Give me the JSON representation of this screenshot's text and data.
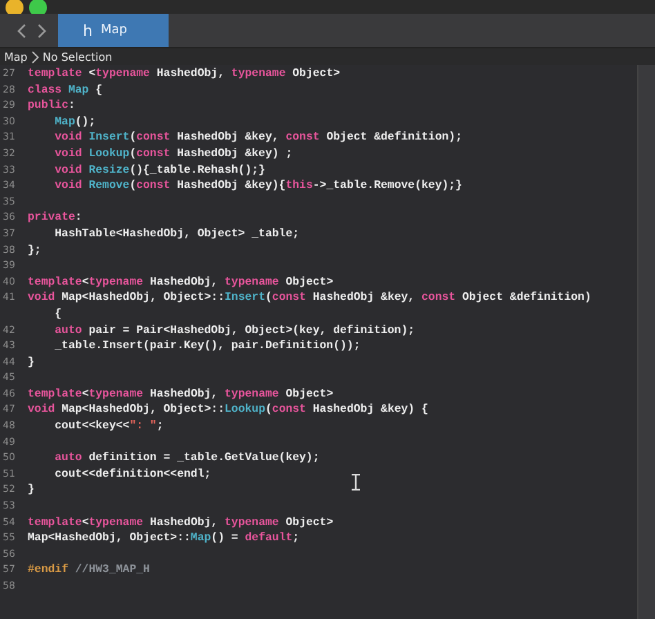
{
  "tabs": [
    {
      "icon": "h",
      "label": "Map",
      "selected": true
    }
  ],
  "breadcrumb": [
    "Map",
    "No Selection"
  ],
  "lines": [
    {
      "number": "27",
      "segments": [
        {
          "kind": "keyword",
          "text": "template"
        },
        {
          "kind": "plain",
          "text": "<",
          "spaced": true
        },
        {
          "kind": "keyword",
          "text": "typename"
        },
        {
          "kind": "plain",
          "text": " HashedObj, "
        },
        {
          "kind": "keyword",
          "text": "typename"
        },
        {
          "kind": "plain",
          "text": " Object>"
        }
      ]
    },
    {
      "number": "28",
      "segments": [
        {
          "kind": "keyword",
          "text": "class"
        },
        {
          "kind": "function",
          "text": "Map",
          "spaced": true
        },
        {
          "kind": "plain",
          "text": " {"
        }
      ]
    },
    {
      "number": "29",
      "segments": [
        {
          "kind": "keyword",
          "text": "public"
        },
        {
          "kind": "plain",
          "text": ":"
        }
      ]
    },
    {
      "number": "30",
      "indent": true,
      "segments": [
        {
          "kind": "function",
          "text": "Map"
        },
        {
          "kind": "plain",
          "text": "();"
        }
      ]
    },
    {
      "number": "31",
      "indent": true,
      "segments": [
        {
          "kind": "keyword",
          "text": "void"
        },
        {
          "kind": "function",
          "text": "Insert",
          "spaced": true
        },
        {
          "kind": "plain",
          "text": "("
        },
        {
          "kind": "keyword",
          "text": "const"
        },
        {
          "kind": "plain",
          "text": " HashedObj &key, "
        },
        {
          "kind": "keyword",
          "text": "const"
        },
        {
          "kind": "plain",
          "text": " Object &definition);"
        }
      ]
    },
    {
      "number": "32",
      "indent": true,
      "segments": [
        {
          "kind": "keyword",
          "text": "void"
        },
        {
          "kind": "function",
          "text": "Lookup",
          "spaced": true
        },
        {
          "kind": "plain",
          "text": "("
        },
        {
          "kind": "keyword",
          "text": "const"
        },
        {
          "kind": "plain",
          "text": " HashedObj &key) ;"
        }
      ]
    },
    {
      "number": "33",
      "indent": true,
      "segments": [
        {
          "kind": "keyword",
          "text": "void"
        },
        {
          "kind": "function",
          "text": "Resize",
          "spaced": true
        },
        {
          "kind": "plain",
          "text": "(){_table.Rehash();}"
        }
      ]
    },
    {
      "number": "34",
      "indent": true,
      "segments": [
        {
          "kind": "keyword",
          "text": "void"
        },
        {
          "kind": "function",
          "text": "Remove",
          "spaced": true
        },
        {
          "kind": "plain",
          "text": "("
        },
        {
          "kind": "keyword",
          "text": "const"
        },
        {
          "kind": "plain",
          "text": " HashedObj &key){"
        },
        {
          "kind": "keyword",
          "text": "this"
        },
        {
          "kind": "plain",
          "text": "->_table.Remove(key);}"
        }
      ]
    },
    {
      "number": "35"
    },
    {
      "number": "36",
      "segments": [
        {
          "kind": "keyword",
          "text": "private"
        },
        {
          "kind": "plain",
          "text": ":"
        }
      ]
    },
    {
      "number": "37",
      "indent": true,
      "segments": [
        {
          "kind": "plain",
          "text": "HashTable<HashedObj, Object> _table;"
        }
      ]
    },
    {
      "number": "38",
      "segments": [
        {
          "kind": "plain",
          "text": "};"
        }
      ]
    },
    {
      "number": "39"
    },
    {
      "number": "40",
      "segments": [
        {
          "kind": "keyword",
          "text": "template"
        },
        {
          "kind": "plain",
          "text": "<"
        },
        {
          "kind": "keyword",
          "text": "typename"
        },
        {
          "kind": "plain",
          "text": " HashedObj, "
        },
        {
          "kind": "keyword",
          "text": "typename"
        },
        {
          "kind": "plain",
          "text": " Object>"
        }
      ]
    },
    {
      "number": "41",
      "segments": [
        {
          "kind": "keyword",
          "text": "void"
        },
        {
          "kind": "plain",
          "text": " Map<HashedObj, Object>::"
        },
        {
          "kind": "function",
          "text": "Insert"
        },
        {
          "kind": "plain",
          "text": "("
        },
        {
          "kind": "keyword",
          "text": "const"
        },
        {
          "kind": "plain",
          "text": " HashedObj &key, "
        },
        {
          "kind": "keyword",
          "text": "const"
        },
        {
          "kind": "plain",
          "text": " Object &definition)"
        }
      ],
      "wrapped": [
        {
          "kind": "plain",
          "text": "{"
        }
      ]
    },
    {
      "number": "42",
      "indent": true,
      "segments": [
        {
          "kind": "keyword",
          "text": "auto"
        },
        {
          "kind": "plain",
          "text": " pair = Pair<HashedObj, Object>(key, definition);"
        }
      ]
    },
    {
      "number": "43",
      "indent": true,
      "segments": [
        {
          "kind": "plain",
          "text": "_table.Insert(pair.Key(), pair.Definition());"
        }
      ]
    },
    {
      "number": "44",
      "segments": [
        {
          "kind": "plain",
          "text": "}"
        }
      ]
    },
    {
      "number": "45"
    },
    {
      "number": "46",
      "segments": [
        {
          "kind": "keyword",
          "text": "template"
        },
        {
          "kind": "plain",
          "text": "<"
        },
        {
          "kind": "keyword",
          "text": "typename"
        },
        {
          "kind": "plain",
          "text": " HashedObj, "
        },
        {
          "kind": "keyword",
          "text": "typename"
        },
        {
          "kind": "plain",
          "text": " Object>"
        }
      ]
    },
    {
      "number": "47",
      "segments": [
        {
          "kind": "keyword",
          "text": "void"
        },
        {
          "kind": "plain",
          "text": " Map<HashedObj, Object>::"
        },
        {
          "kind": "function",
          "text": "Lookup"
        },
        {
          "kind": "plain",
          "text": "("
        },
        {
          "kind": "keyword",
          "text": "const"
        },
        {
          "kind": "plain",
          "text": " HashedObj &key) {"
        }
      ]
    },
    {
      "number": "48",
      "indent": true,
      "segments": [
        {
          "kind": "plain",
          "text": "cout<<key<<"
        },
        {
          "kind": "string",
          "text": "\": \""
        },
        {
          "kind": "plain",
          "text": ";"
        }
      ]
    },
    {
      "number": "49"
    },
    {
      "number": "50",
      "indent": true,
      "segments": [
        {
          "kind": "keyword",
          "text": "auto"
        },
        {
          "kind": "plain",
          "text": " definition = _table.GetValue(key);"
        }
      ]
    },
    {
      "number": "51",
      "indent": true,
      "segments": [
        {
          "kind": "plain",
          "text": "cout<<definition<<endl;"
        }
      ]
    },
    {
      "number": "52",
      "segments": [
        {
          "kind": "plain",
          "text": "}"
        }
      ]
    },
    {
      "number": "53"
    },
    {
      "number": "54",
      "segments": [
        {
          "kind": "keyword",
          "text": "template"
        },
        {
          "kind": "plain",
          "text": "<"
        },
        {
          "kind": "keyword",
          "text": "typename"
        },
        {
          "kind": "plain",
          "text": " HashedObj, "
        },
        {
          "kind": "keyword",
          "text": "typename"
        },
        {
          "kind": "plain",
          "text": " Object>"
        }
      ]
    },
    {
      "number": "55",
      "segments": [
        {
          "kind": "plain",
          "text": "Map<HashedObj, Object>::"
        },
        {
          "kind": "function",
          "text": "Map"
        },
        {
          "kind": "plain",
          "text": "() = "
        },
        {
          "kind": "keyword",
          "text": "default"
        },
        {
          "kind": "plain",
          "text": ";"
        }
      ]
    },
    {
      "number": "56"
    },
    {
      "number": "57",
      "segments": [
        {
          "kind": "preprocessor",
          "text": "#endif"
        },
        {
          "kind": "comment",
          "text": "//HW3_MAP_H",
          "spaced": true
        }
      ]
    },
    {
      "number": "58"
    }
  ]
}
